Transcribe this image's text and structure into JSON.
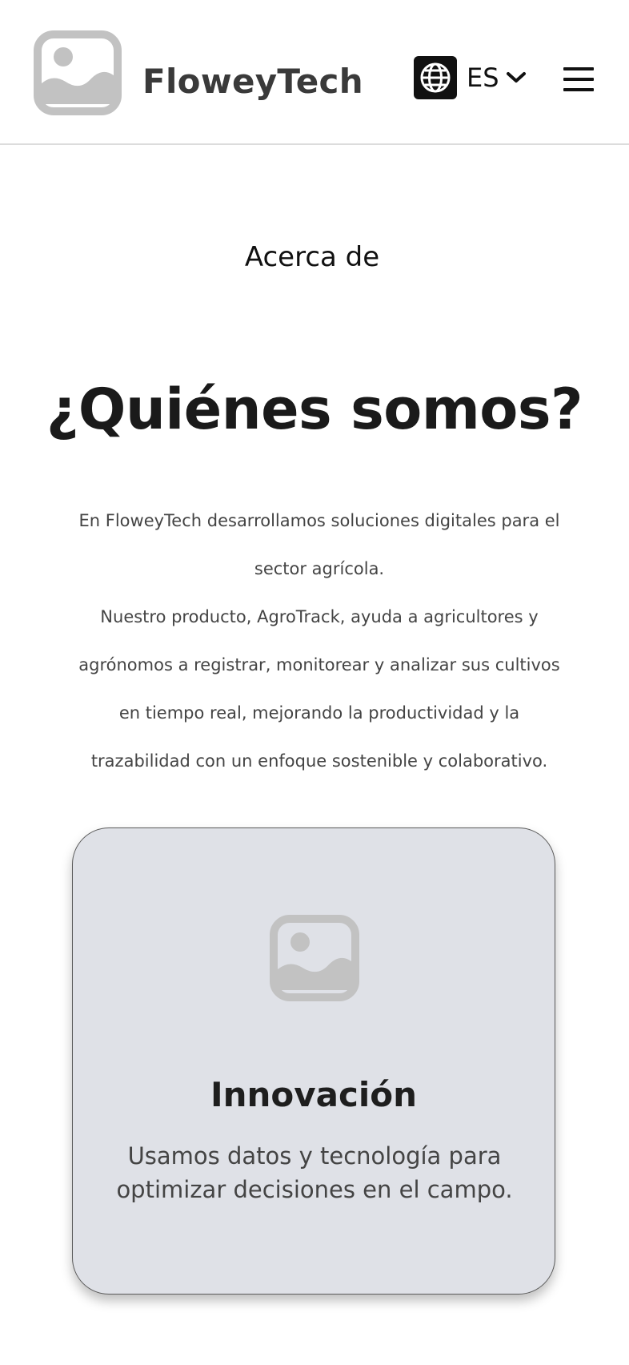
{
  "header": {
    "brand": "FloweyTech",
    "logo_icon": "image-placeholder-icon",
    "language": {
      "icon": "globe-icon",
      "code": "ES",
      "dropdown_icon": "chevron-down-icon"
    },
    "menu_icon": "hamburger-menu-icon"
  },
  "about": {
    "label": "Acerca de",
    "title": "¿Quiénes somos?",
    "intro_line_1": "En FloweyTech desarrollamos soluciones digitales para el sector agrícola.",
    "intro_line_2": "Nuestro producto, AgroTrack, ayuda a agricultores y agrónomos a registrar, monitorear y analizar sus cultivos en tiempo real, mejorando la productividad y la trazabilidad con un enfoque sostenible y colaborativo."
  },
  "cards": [
    {
      "icon": "image-placeholder-icon",
      "title": "Innovación",
      "text": "Usamos datos y tecnología para optimizar decisiones en el campo."
    }
  ],
  "colors": {
    "card_background": "#dfe1e7",
    "placeholder_icon": "#c2c2c2",
    "text_dark": "#1a1a1a",
    "text_body": "#444444"
  }
}
